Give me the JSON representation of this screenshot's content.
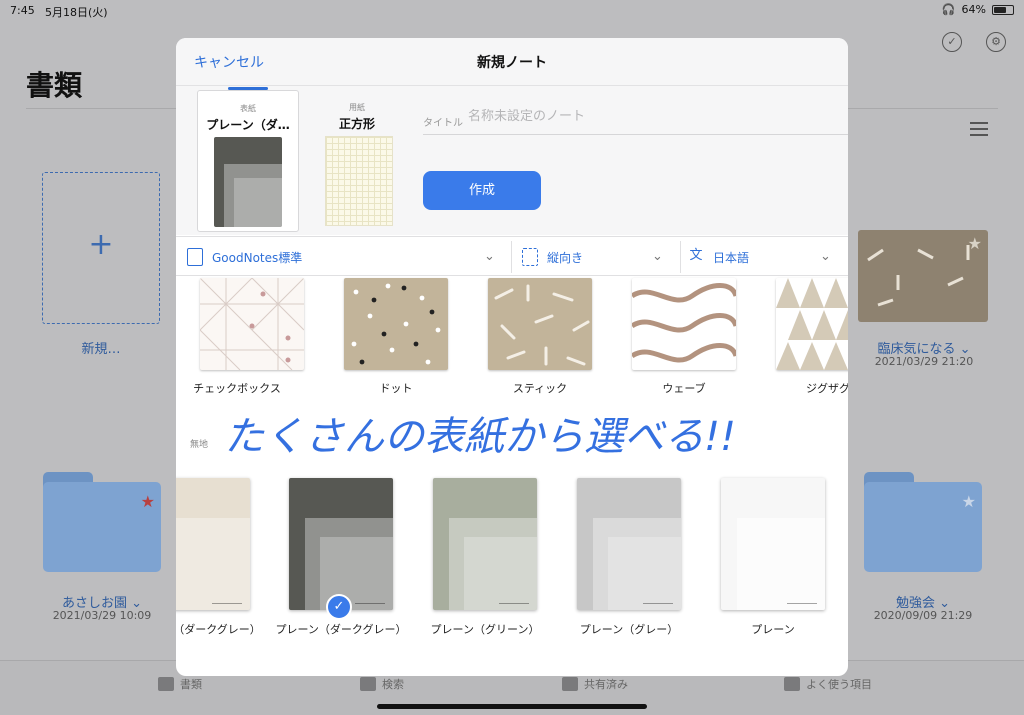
{
  "status_bar": {
    "time": "7:45",
    "date": "5月18日(火)",
    "battery": "64%",
    "battery_level": 0.64
  },
  "page": {
    "title": "書類"
  },
  "library": {
    "new_label": "新規…",
    "notebook_right": {
      "title": "臨床気になる ⌄",
      "date": "2021/03/29 21:20"
    },
    "folder_left": {
      "title": "あさしお園 ⌄",
      "date": "2021/03/29 10:09"
    },
    "folder_right": {
      "title": "勉強会 ⌄",
      "date": "2020/09/09 21:29"
    }
  },
  "tabbar": {
    "items": [
      "書類",
      "検索",
      "共有済み",
      "よく使う項目"
    ]
  },
  "modal": {
    "cancel": "キャンセル",
    "title": "新規ノート",
    "cover_small": "表紙",
    "cover_name": "プレーン（ダ…",
    "paper_small": "用紙",
    "paper_name": "正方形",
    "title_label": "タイトル",
    "title_placeholder": "名称未設定のノート",
    "create": "作成",
    "filters": {
      "template": "GoodNotes標準",
      "orientation": "縦向き",
      "language": "日本語"
    },
    "patterns": [
      "チェックボックス",
      "ドット",
      "スティック",
      "ウェーブ",
      "ジグザグ"
    ],
    "section_label": "無地",
    "handwriting": "たくさんの表紙から選べる!!",
    "covers": [
      "（ダークグレー）",
      "プレーン（ダークグレー）",
      "プレーン（グリーン）",
      "プレーン（グレー）",
      "プレーン"
    ]
  },
  "colors": {
    "accent": "#3a7bea",
    "handwriting": "#3470e0",
    "cover_darkgrey": "#575853",
    "cover_green": "#a8ae9e",
    "cover_grey": "#c7c7c7",
    "cover_beige": "#e7dfd1",
    "pattern_khaki": "#c2b49a"
  }
}
